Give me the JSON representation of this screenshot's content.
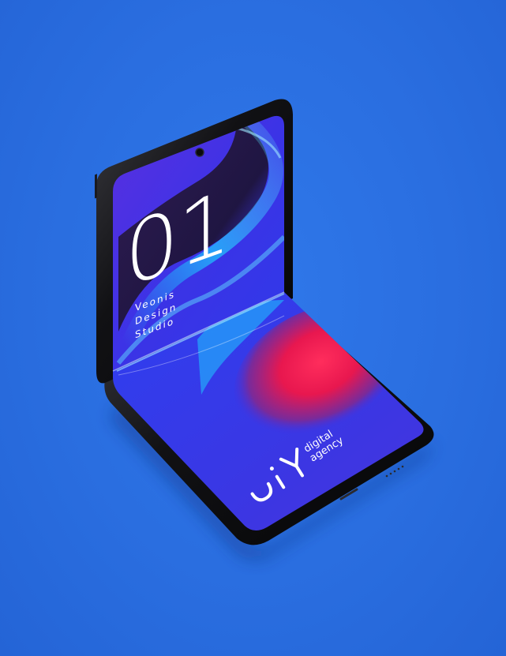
{
  "colors": {
    "background": "#2a6ee0",
    "screen_base": "#3b2fd9",
    "accent_pink": "#e8174f",
    "accent_cyan": "#1ec9ff",
    "phone_frame": "#111114"
  },
  "top_screen": {
    "number": "01",
    "studio_lines": [
      "Veonis",
      "Design",
      "Studio"
    ]
  },
  "bottom_screen": {
    "logo_mark": "uiY",
    "tagline_lines": [
      "digital",
      "agency"
    ]
  },
  "icons": [
    "front-camera-icon",
    "brand-logo-icon"
  ]
}
